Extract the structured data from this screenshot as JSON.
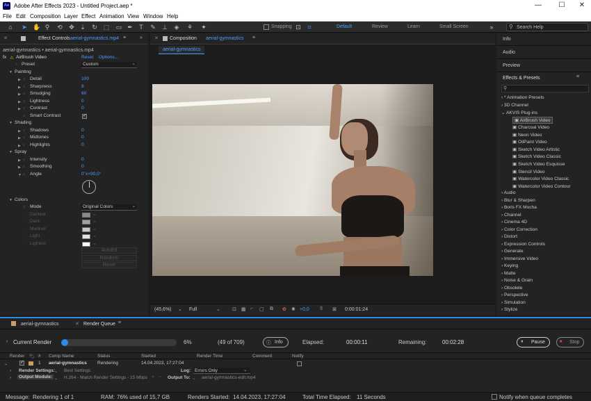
{
  "title_bar": {
    "title": "Adobe After Effects 2023 - Untitled Project.aep *",
    "app_icon": "Ae",
    "minimize": "—",
    "maximize": "☐",
    "close": "✕"
  },
  "menu": [
    "File",
    "Edit",
    "Composition",
    "Layer",
    "Effect",
    "Animation",
    "View",
    "Window",
    "Help"
  ],
  "toolbar": {
    "snapping": "Snapping",
    "workspaces": [
      "Default",
      "Review",
      "Learn",
      "Small Screen"
    ],
    "search_placeholder": "Search Help"
  },
  "effect_controls": {
    "tab_label": "Effect Controls",
    "tab_file": "aerial-gymnastics.mp4",
    "breadcrumb": "aerial-gymnastics • aerial-gymnastics.mp4",
    "effect_name": "AirBrush Video",
    "reset": "Reset",
    "options": "Options...",
    "preset_label": "Preset",
    "preset_value": "Custom",
    "groups": {
      "painting": "Painting",
      "shading": "Shading",
      "spray": "Spray",
      "colors": "Colors"
    },
    "params": [
      {
        "label": "Detail",
        "value": "100"
      },
      {
        "label": "Sharpness",
        "value": "8"
      },
      {
        "label": "Smudging",
        "value": "60"
      },
      {
        "label": "Lightness",
        "value": "0"
      },
      {
        "label": "Contrast",
        "value": "0"
      },
      {
        "label": "Smart Contrast",
        "value": ""
      },
      {
        "label": "Shadows",
        "value": "0"
      },
      {
        "label": "Midtones",
        "value": "0"
      },
      {
        "label": "Highlights",
        "value": "0"
      },
      {
        "label": "Intensity",
        "value": "0"
      },
      {
        "label": "Smoothing",
        "value": "0"
      },
      {
        "label": "Angle",
        "value": "0˚x+90,0°"
      }
    ],
    "mode_label": "Mode",
    "mode_value": "Original Colors",
    "color_slots": [
      "Darkest",
      "Dark",
      "Medium",
      "Light",
      "Lightest"
    ],
    "buttons": [
      "AutoEd",
      "Random",
      "Reset"
    ]
  },
  "composition": {
    "tab_label": "Composition",
    "tab_name": "aerial-gymnastics",
    "sub_tab": "aerial-gymnastics",
    "zoom": "(45,6%)",
    "resolution": "Full",
    "exposure": "+0,0",
    "timecode": "0:00:01:24"
  },
  "right_panels": {
    "info": "Info",
    "audio": "Audio",
    "preview": "Preview",
    "effects_presets": "Effects & Presets"
  },
  "effects_list": {
    "top": [
      "* Animation Presets",
      "3D Channel",
      "AKVIS Plug-ins"
    ],
    "akvis": [
      "AirBrush Video",
      "Charcoal Video",
      "Neon Video",
      "OilPaint Video",
      "Sketch Video Artistic",
      "Sketch Video Classic",
      "Sketch Video Esquisse",
      "Stencil Video",
      "Watercolor Video Classic",
      "Watercolor Video Contour"
    ],
    "categories": [
      "Audio",
      "Blur & Sharpen",
      "Boris FX Mocha",
      "Channel",
      "Cinema 4D",
      "Color Correction",
      "Distort",
      "Expression Controls",
      "Generate",
      "Immersive Video",
      "Keying",
      "Matte",
      "Noise & Grain",
      "Obsolete",
      "Perspective",
      "Simulation",
      "Stylize"
    ]
  },
  "render_queue": {
    "tab_comp": "aerial-gymnastics",
    "tab_rq": "Render Queue",
    "current_render": "Current Render",
    "progress": 0.06,
    "percent": "6%",
    "frames": "(49 of 709)",
    "info_btn": "Info",
    "elapsed_label": "Elapsed:",
    "elapsed": "00:00:11",
    "remaining_label": "Remaining:",
    "remaining": "00:02:28",
    "pause": "Pause",
    "stop": "Stop",
    "headers": [
      "Render",
      "Comp Name",
      "Status",
      "Started",
      "Render Time",
      "Comment",
      "Notify"
    ],
    "item": {
      "index": "1",
      "comp": "aerial-gymnastics",
      "status": "Rendering",
      "started": "14.04.2023, 17:27:04"
    },
    "render_settings_label": "Render Settings:",
    "render_settings": "Best Settings",
    "log_label": "Log:",
    "log": "Errors Only",
    "output_module_label": "Output Module:",
    "output_module": "H.264 - Match Render Settings - 15 Mbps",
    "output_to_label": "Output To:",
    "output_to": "aerial-gymnastics-edit.mp4"
  },
  "status_bar": {
    "message_label": "Message:",
    "message": "Rendering 1 of 1",
    "ram_label": "RAM:",
    "ram": "76% used of 15,7 GB",
    "renders_started_label": "Renders Started:",
    "renders_started": "14.04.2023, 17:27:04",
    "total_label": "Total Time Elapsed:",
    "total": "11 Seconds",
    "notify": "Notify when queue completes"
  }
}
